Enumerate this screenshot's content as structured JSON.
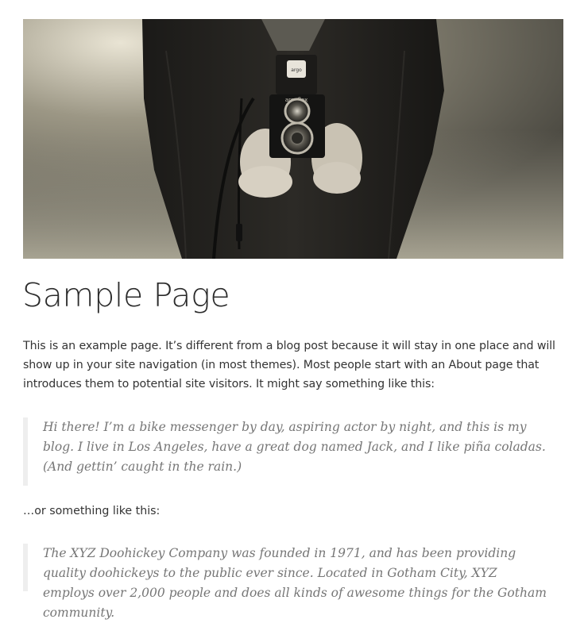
{
  "page": {
    "title": "Sample Page",
    "intro": "This is an example page. It’s different from a blog post because it will stay in one place and will show up in your site navigation (in most themes). Most people start with an About page that introduces them to potential site visitors. It might say something like this:",
    "quote_1": "Hi there! I’m a bike messenger by day, aspiring actor by night, and this is my blog. I live in Los Angeles, have a great dog named Jack, and I like piña coladas. (And gettin’ caught in the rain.)",
    "or_line": "…or something like this:",
    "quote_2": "The XYZ Doohickey Company was founded in 1971, and has been providing quality doohickeys to the public ever since. Located in Gotham City, XYZ employs over 2,000 people and does all kinds of awesome things for the Gotham community."
  },
  "hero_image": {
    "camera_lettering": "argoflex",
    "alt": ""
  },
  "colors": {
    "title": "#2b2b2b",
    "body_text": "#333333",
    "quote_text": "#767676",
    "quote_border": "#eeeeee"
  }
}
